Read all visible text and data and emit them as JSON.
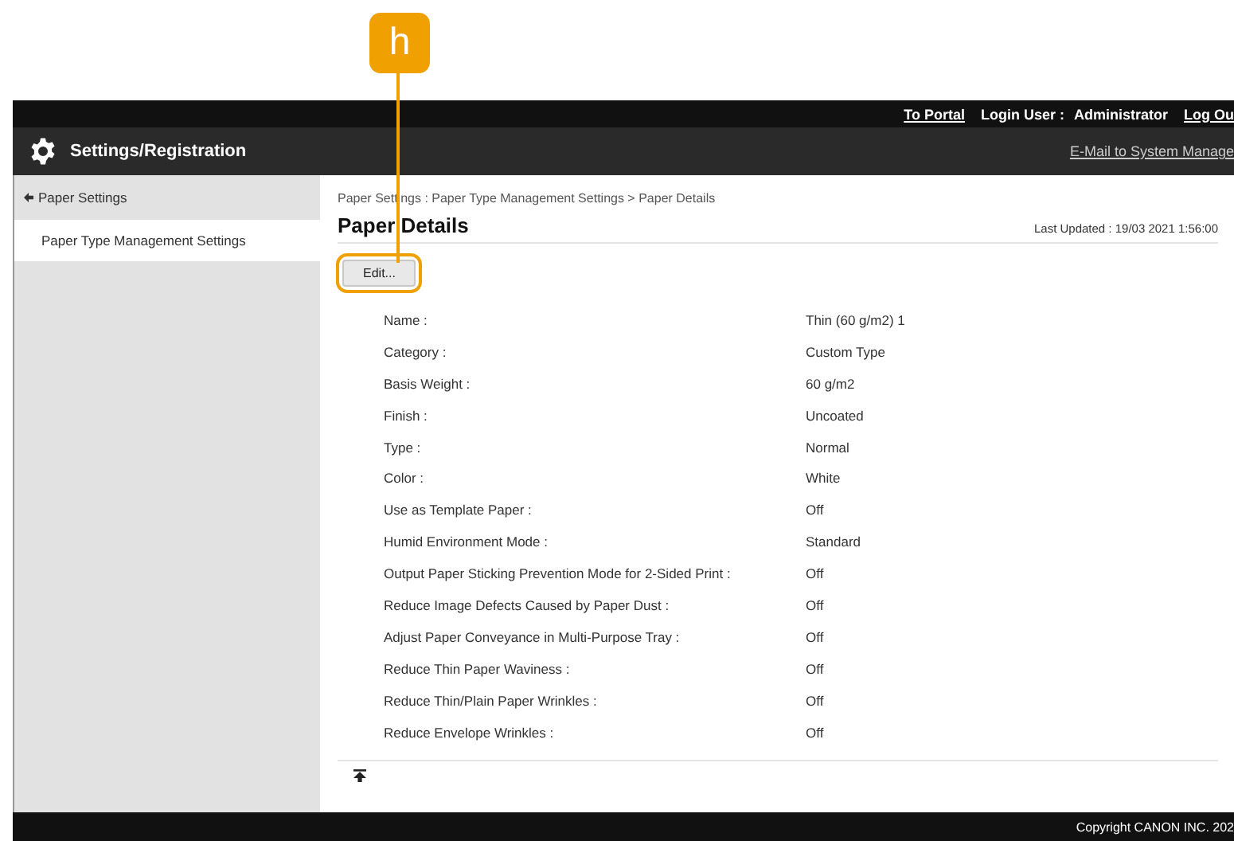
{
  "callout": {
    "label": "h"
  },
  "top_bar": {
    "portal_link": "To Portal",
    "login_label": "Login User :",
    "user": "Administrator",
    "logout_link": "Log Ou"
  },
  "header": {
    "title": "Settings/Registration",
    "mail_link": "E-Mail to System Manage"
  },
  "sidebar": {
    "items": [
      {
        "label": "Paper Settings",
        "kind": "back",
        "selected": false
      },
      {
        "label": "Paper Type Management Settings",
        "kind": "page",
        "selected": true
      }
    ]
  },
  "breadcrumb": "Paper Settings : Paper Type Management Settings > Paper Details",
  "page_title": "Paper Details",
  "last_updated": "Last Updated : 19/03 2021 1:56:00",
  "edit_button": {
    "label": "Edit...",
    "highlighted": true
  },
  "details": [
    {
      "label": "Name :",
      "value": "Thin (60 g/m2) 1"
    },
    {
      "label": "Category :",
      "value": "Custom Type"
    },
    {
      "label": "Basis Weight :",
      "value": "60 g/m2"
    },
    {
      "label": "Finish :",
      "value": "Uncoated"
    },
    {
      "label": "Type :",
      "value": "Normal"
    },
    {
      "label": "Color :",
      "value": "White"
    },
    {
      "label": "Use as Template Paper :",
      "value": "Off"
    },
    {
      "label": "Humid Environment Mode :",
      "value": "Standard"
    },
    {
      "label": "Output Paper Sticking Prevention Mode for 2-Sided Print :",
      "value": "Off"
    },
    {
      "label": "Reduce Image Defects Caused by Paper Dust :",
      "value": "Off"
    },
    {
      "label": "Adjust Paper Conveyance in Multi-Purpose Tray :",
      "value": "Off"
    },
    {
      "label": "Reduce Thin Paper Waviness :",
      "value": "Off"
    },
    {
      "label": "Reduce Thin/Plain Paper Wrinkles :",
      "value": "Off"
    },
    {
      "label": "Reduce Envelope Wrinkles :",
      "value": "Off"
    }
  ],
  "footer": {
    "copyright": "Copyright CANON INC. 202"
  }
}
